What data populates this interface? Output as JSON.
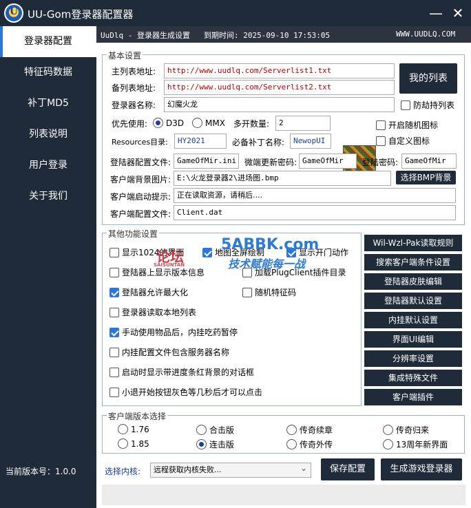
{
  "app": {
    "title": "UU-Gom登录器配置器",
    "logo_text": "U",
    "version": "当前版本号：1.0.0"
  },
  "window": {
    "minimize_glyph": "—",
    "close_glyph": "✕"
  },
  "sidebar": {
    "items": [
      {
        "label": "登录器配置"
      },
      {
        "label": "特征码数据"
      },
      {
        "label": "补丁MD5"
      },
      {
        "label": "列表说明"
      },
      {
        "label": "用户登录"
      },
      {
        "label": "关于我们"
      }
    ]
  },
  "infobar": {
    "product": "UuDlq - 登录器生成设置",
    "expire": "到期时间: 2025-09-10 17:53:05",
    "site": "WWW.UUDLQ.COM"
  },
  "basic": {
    "title": "基本设置",
    "primary_list_label": "主列表地址:",
    "primary_list_value": "http://www.uudlq.com/Serverlist1.txt",
    "backup_list_label": "备列表地址:",
    "backup_list_value": "http://www.uudlq.com/Serverlist2.txt",
    "my_list_button": "我的列表",
    "name_label": "登录器名称:",
    "name_value": "幻魔火龙",
    "anti_hijack": "防劫持列表",
    "priority_label": "优先使用:",
    "d3d": "D3D",
    "mmx": "MMX",
    "multi_label": "多开数量:",
    "multi_value": "2",
    "random_icon": "开启随机图标",
    "custom_icon": "自定义图标",
    "resources_label": "Resources目录:",
    "resources_value": "HY2021",
    "patch_label": "必备补丁名称:",
    "patch_value": "NewopUI",
    "config_file_label": "登陆器配置文件:",
    "config_file_value": "GameOfMir.ini",
    "update_pwd_label": "微端更新密码:",
    "update_pwd_value": "GameOfMir",
    "login_pwd_label": "登陆密码:",
    "login_pwd_value": "GameOfMir",
    "bg_label": "客户端背景图片:",
    "bg_value": "E:\\火龙登录器2\\进场图.bmp",
    "bg_button": "选择BMP背景",
    "hint_label": "客户端启动提示:",
    "hint_value": "正在读取资源，请稍后....",
    "client_cfg_label": "客户端配置文件:",
    "client_cfg_value": "Client.dat"
  },
  "other": {
    "title": "其他功能设置",
    "options": [
      {
        "label": "显示1024的界面",
        "checked": false
      },
      {
        "label": "地图全屏绘制",
        "checked": true
      },
      {
        "label": "显示开门动作",
        "checked": true
      },
      {
        "label": "登陆器上显示版本信息",
        "checked": false
      },
      {
        "label": "加载PlugClient插件目录",
        "checked": false
      },
      {
        "label": "登陆器允许最大化",
        "checked": true
      },
      {
        "label": "随机特征码",
        "checked": false
      },
      {
        "label": "登录器读取本地列表",
        "checked": false
      },
      {
        "label": "手动使用物品后，内挂吃药暂停",
        "checked": true
      },
      {
        "label": "内挂配置文件包含服务器名称",
        "checked": false
      },
      {
        "label": "启动时显示带进度条红背景的对话框",
        "checked": false
      },
      {
        "label": "小退开始按钮灰色等几秒后才可以点击",
        "checked": false
      }
    ]
  },
  "right_buttons": [
    "Wil-Wzl-Pak读取规则",
    "搜索客户端条件设置",
    "登陆器皮肤编辑",
    "登陆器默认设置",
    "内挂默认设置",
    "界面UI编辑",
    "分辨率设置",
    "集成特殊文件",
    "客户端插件"
  ],
  "client_version": {
    "title": "客户端版本选择",
    "options": [
      {
        "label": "1.76",
        "selected": false
      },
      {
        "label": "合击版",
        "selected": false
      },
      {
        "label": "传奇续章",
        "selected": false
      },
      {
        "label": "传奇归来",
        "selected": false
      },
      {
        "label": "1.85",
        "selected": false
      },
      {
        "label": "连击版",
        "selected": true
      },
      {
        "label": "传奇外传",
        "selected": false
      },
      {
        "label": "13周年新界面",
        "selected": false
      }
    ]
  },
  "kernel": {
    "label": "选择内核:",
    "value": "远程获取内核失败...",
    "arrow": "⌄"
  },
  "actions": {
    "save": "保存配置",
    "generate": "生成游戏登录器"
  },
  "watermark": {
    "brand": "5ABBK.com",
    "slogan": "技术赋能每一战",
    "small": "论坛",
    "tiny": "SAISUNTAN"
  }
}
